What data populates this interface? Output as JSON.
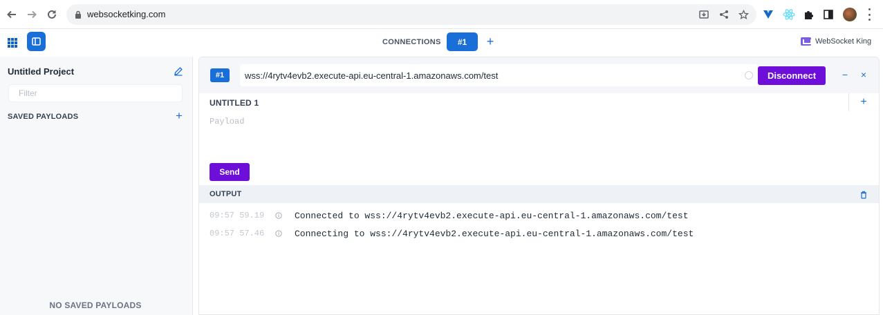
{
  "browser": {
    "url": "websocketking.com"
  },
  "header": {
    "connections_label": "CONNECTIONS",
    "active_tab": "#1",
    "add_tab": "+",
    "brand": "WebSocket King"
  },
  "sidebar": {
    "project_title": "Untitled Project",
    "filter_placeholder": "Filter",
    "saved_payloads_title": "SAVED PAYLOADS",
    "empty_text": "NO SAVED PAYLOADS"
  },
  "connection": {
    "badge": "#1",
    "url": "wss://4rytv4evb2.execute-api.eu-central-1.amazonaws.com/test",
    "disconnect_label": "Disconnect",
    "minimize_label": "−",
    "close_label": "×"
  },
  "payload": {
    "title": "UNTITLED 1",
    "placeholder": "Payload",
    "send_label": "Send"
  },
  "output": {
    "title": "OUTPUT",
    "logs": [
      {
        "time": "09:57 59.19",
        "message": "Connected to wss://4rytv4evb2.execute-api.eu-central-1.amazonaws.com/test"
      },
      {
        "time": "09:57 57.46",
        "message": "Connecting to wss://4rytv4evb2.execute-api.eu-central-1.amazonaws.com/test"
      }
    ]
  },
  "colors": {
    "accent": "#1a6ed8",
    "button_purple": "#6d0fd8"
  }
}
